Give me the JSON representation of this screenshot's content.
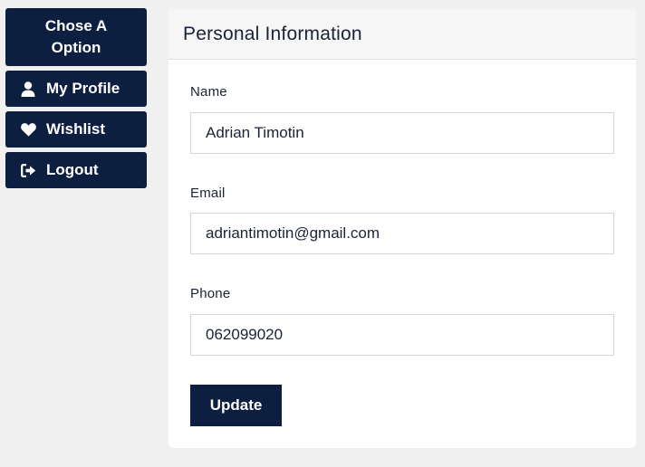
{
  "sidebar": {
    "header_line1": "Chose A",
    "header_line2": "Option",
    "items": [
      {
        "label": "My Profile",
        "icon": "user-icon"
      },
      {
        "label": "Wishlist",
        "icon": "heart-icon"
      },
      {
        "label": "Logout",
        "icon": "logout-icon"
      }
    ]
  },
  "card": {
    "title": "Personal Information",
    "fields": [
      {
        "label": "Name",
        "value": "Adrian Timotin"
      },
      {
        "label": "Email",
        "value": "adriantimotin@gmail.com"
      },
      {
        "label": "Phone",
        "value": "062099020"
      }
    ],
    "update_label": "Update"
  },
  "colors": {
    "primary": "#0d1f40",
    "background": "#f0f0f0",
    "card_header": "#f6f6f6"
  }
}
